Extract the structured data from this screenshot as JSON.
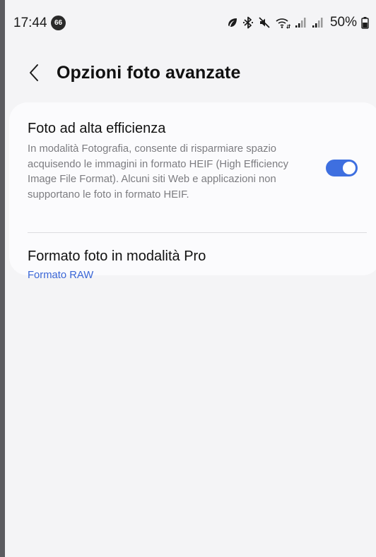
{
  "status_bar": {
    "time": "17:44",
    "notification_count": "66",
    "battery": "50%",
    "icons": [
      "leaf-icon",
      "bluetooth-icon",
      "mute-icon",
      "wifi-icon",
      "signal-icon",
      "signal-icon",
      "battery-icon"
    ]
  },
  "header": {
    "back_icon": "chevron-left-icon",
    "title": "Opzioni foto avanzate"
  },
  "settings": {
    "heif": {
      "title": "Foto ad alta efficienza",
      "description": "In modalità Fotografia, consente di risparmiare spazio acquisendo le immagini in formato HEIF (High Efficiency Image File Format). Alcuni siti Web e applicazioni non supportano le foto in formato HEIF.",
      "enabled": true
    },
    "pro_format": {
      "title": "Formato foto in modalità Pro",
      "value": "Formato RAW"
    }
  },
  "colors": {
    "accent": "#3e6fe0",
    "link": "#3a66d6",
    "background": "#f4f4f6",
    "card": "#fbfbfd"
  }
}
